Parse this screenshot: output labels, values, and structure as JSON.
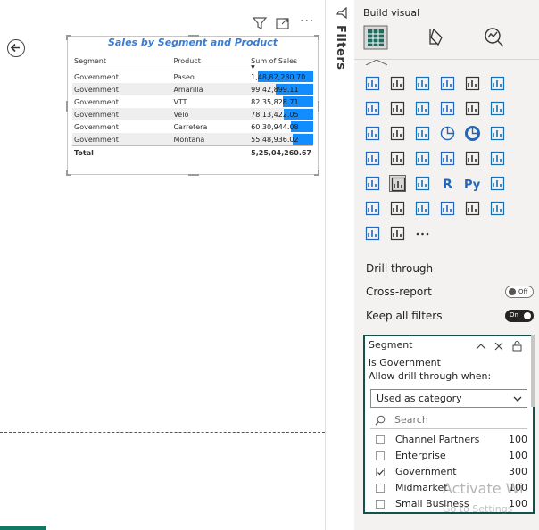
{
  "visual": {
    "title": "Sales by Segment and Product",
    "columns": [
      "Segment",
      "Product",
      "Sum of Sales"
    ],
    "rows": [
      {
        "segment": "Government",
        "product": "Paseo",
        "sales": "1,48,82,230.70",
        "fraction": 1.0
      },
      {
        "segment": "Government",
        "product": "Amarilla",
        "sales": "99,42,899.11",
        "fraction": 0.67
      },
      {
        "segment": "Government",
        "product": "VTT",
        "sales": "82,35,828.71",
        "fraction": 0.55
      },
      {
        "segment": "Government",
        "product": "Velo",
        "sales": "78,13,422.05",
        "fraction": 0.53
      },
      {
        "segment": "Government",
        "product": "Carretera",
        "sales": "60,30,944.08",
        "fraction": 0.41
      },
      {
        "segment": "Government",
        "product": "Montana",
        "sales": "55,48,936.02",
        "fraction": 0.37
      }
    ],
    "total_label": "Total",
    "total_value": "5,25,04,260.67"
  },
  "filters_pane": {
    "label": "Filters"
  },
  "build_pane": {
    "title": "Build visual",
    "drill_through": {
      "heading": "Drill through",
      "cross_report_label": "Cross-report",
      "cross_report_state": "Off",
      "keep_all_filters_label": "Keep all filters",
      "keep_all_filters_state": "On"
    },
    "filter_card": {
      "field": "Segment",
      "condition": "is Government",
      "allow_label": "Allow drill through when:",
      "mode": "Used as category",
      "search_placeholder": "Search",
      "items": [
        {
          "name": "Channel Partners",
          "count": "100",
          "checked": false
        },
        {
          "name": "Enterprise",
          "count": "100",
          "checked": false
        },
        {
          "name": "Government",
          "count": "300",
          "checked": true
        },
        {
          "name": "Midmarket",
          "count": "100",
          "checked": false
        },
        {
          "name": "Small Business",
          "count": "100",
          "checked": false
        }
      ]
    },
    "more_glyph": "···"
  },
  "watermark": {
    "line1": "Activate Wi",
    "line2": "Go to Settings"
  },
  "colors": {
    "accent": "#118dff",
    "title_blue": "#3a7bd5",
    "card_border": "#11524a",
    "bottom_tab": "#117865"
  }
}
